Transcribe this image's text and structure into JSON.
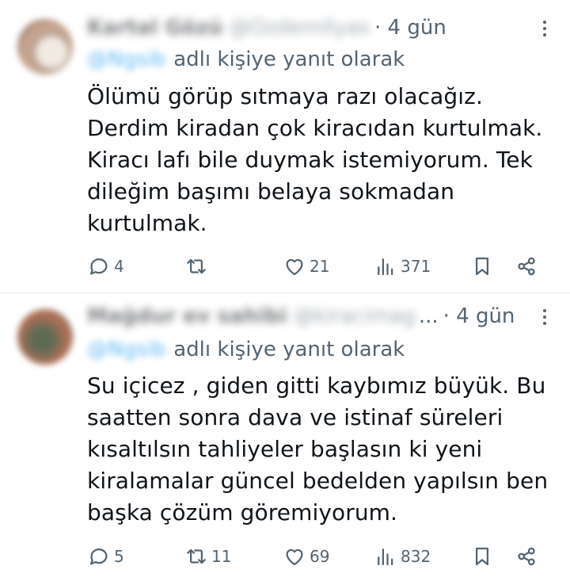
{
  "tweets": [
    {
      "author_name": "Kartal Gözü",
      "author_handle": "@OzdemIlyas",
      "time": "· 4 gün",
      "reply_handle": "@Ngsib",
      "reply_suffix": "adlı kişiye yanıt olarak",
      "text_lines": [
        "Ölümü görüp sıtmaya razı olacağız.",
        "Derdim kiradan çok kiracıdan kurtulmak.",
        "Kiracı lafı bile duymak istemiyorum. Tek",
        "dileğim başımı belaya sokmadan",
        "kurtulmak."
      ],
      "replies": "4",
      "retweets": "",
      "likes": "21",
      "views": "371"
    },
    {
      "author_name": "Mağdur ev sahibi",
      "author_handle": "@kiracimag",
      "ellipsis": "...",
      "time": "· 4 gün",
      "reply_handle": "@Ngsib",
      "reply_suffix": "adlı kişiye yanıt olarak",
      "text_lines": [
        "Su içicez , giden gitti kaybımız büyük. Bu",
        "saatten sonra dava ve istinaf süreleri",
        "kısaltılsın tahliyeler başlasın ki yeni",
        "kiralamalar güncel bedelden yapılsın ben",
        "başka çözüm göremiyorum."
      ],
      "replies": "5",
      "retweets": "11",
      "likes": "69",
      "views": "832"
    }
  ],
  "icons": {
    "reply": "reply-icon",
    "retweet": "retweet-icon",
    "like": "heart-icon",
    "views": "views-icon",
    "bookmark": "bookmark-icon",
    "share": "share-icon",
    "more": "more-icon"
  },
  "colors": {
    "text": "#0f1419",
    "secondary": "#536471",
    "link": "#1d9bf0",
    "divider": "#e6e9eb"
  }
}
